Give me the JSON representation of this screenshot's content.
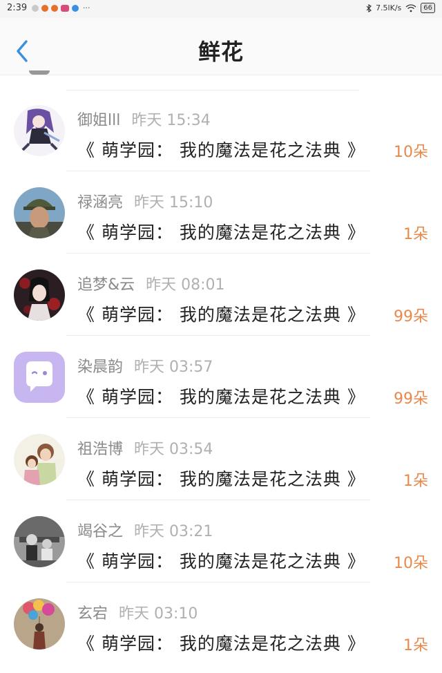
{
  "status_bar": {
    "time": "2:39",
    "net_speed": "7.5lK/s",
    "battery": "66",
    "app_icon_colors": [
      "#c9c9c9",
      "#e66f2c",
      "#e66f2c",
      "#d94b7a",
      "#3a8fe0"
    ],
    "more": "···"
  },
  "header": {
    "title": "鲜花",
    "back_icon": "chevron-left-icon",
    "accent_color": "#3a8fe0"
  },
  "list": {
    "items": [
      {
        "name": "御姐lll",
        "time": "昨天 15:34",
        "book": "《 萌学园：  我的魔法是花之法典 》",
        "amount": "10朵"
      },
      {
        "name": "禄涵亮",
        "time": "昨天 15:10",
        "book": "《 萌学园：  我的魔法是花之法典 》",
        "amount": "1朵"
      },
      {
        "name": "追梦&云",
        "time": "昨天 08:01",
        "book": "《 萌学园：  我的魔法是花之法典 》",
        "amount": "99朵"
      },
      {
        "name": "染晨韵",
        "time": "昨天 03:57",
        "book": "《 萌学园：  我的魔法是花之法典 》",
        "amount": "99朵"
      },
      {
        "name": "祖浩博",
        "time": "昨天 03:54",
        "book": "《 萌学园：  我的魔法是花之法典 》",
        "amount": "1朵"
      },
      {
        "name": "竭谷之",
        "time": "昨天 03:21",
        "book": "《 萌学园：  我的魔法是花之法典 》",
        "amount": "10朵"
      },
      {
        "name": "玄宕",
        "time": "昨天 03:10",
        "book": "《 萌学园：  我的魔法是花之法典 》",
        "amount": "1朵"
      }
    ]
  },
  "colors": {
    "amount": "#e6894a",
    "name": "#8a8a8a",
    "time": "#b0b0b0"
  }
}
